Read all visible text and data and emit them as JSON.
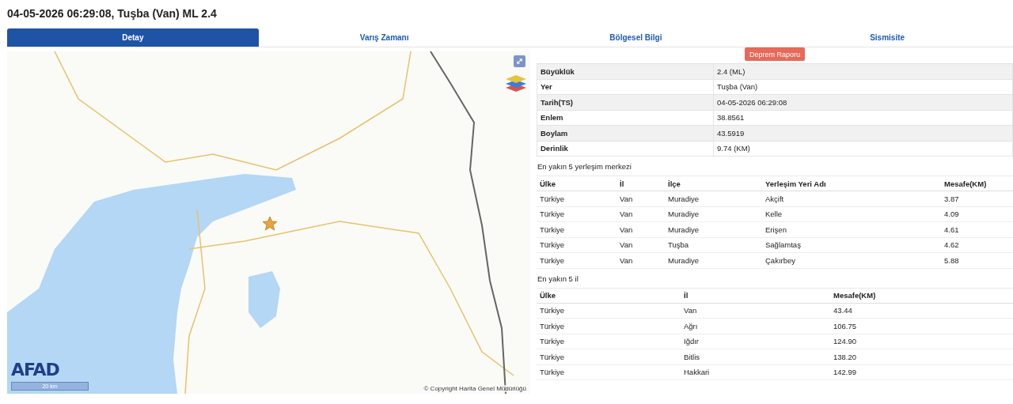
{
  "title": "04-05-2026 06:29:08, Tuşba (Van) ML 2.4",
  "tabs": [
    {
      "label": "Detay",
      "selected": true
    },
    {
      "label": "Varış Zamanı",
      "selected": false
    },
    {
      "label": "Bölgesel Bilgi",
      "selected": false
    },
    {
      "label": "Sismisite",
      "selected": false
    }
  ],
  "map": {
    "logo": "AFAD",
    "scale": "20 km",
    "copyright": "© Copyright Harita Genel Müdürlüğü"
  },
  "report_button": "Deprem Raporu",
  "details": [
    {
      "label": "Büyüklük",
      "value": "2.4 (ML)"
    },
    {
      "label": "Yer",
      "value": "Tuşba (Van)"
    },
    {
      "label": "Tarih(TS)",
      "value": "04-05-2026 06:29:08"
    },
    {
      "label": "Enlem",
      "value": "38.8561"
    },
    {
      "label": "Boylam",
      "value": "43.5919"
    },
    {
      "label": "Derinlik",
      "value": "9.74 (KM)"
    }
  ],
  "settlements": {
    "caption": "En yakın 5 yerleşim merkezi",
    "columns": [
      "Ülke",
      "İl",
      "İlçe",
      "Yerleşim Yeri Adı",
      "Mesafe(KM)"
    ],
    "rows": [
      [
        "Türkiye",
        "Van",
        "Muradiye",
        "Akçift",
        "3.87"
      ],
      [
        "Türkiye",
        "Van",
        "Muradiye",
        "Kelle",
        "4.09"
      ],
      [
        "Türkiye",
        "Van",
        "Muradiye",
        "Erişen",
        "4.61"
      ],
      [
        "Türkiye",
        "Van",
        "Tuşba",
        "Sağlamtaş",
        "4.62"
      ],
      [
        "Türkiye",
        "Van",
        "Muradiye",
        "Çakırbey",
        "5.88"
      ]
    ]
  },
  "provinces": {
    "caption": "En yakın 5 il",
    "columns": [
      "Ülke",
      "İl",
      "Mesafe(KM)"
    ],
    "rows": [
      [
        "Türkiye",
        "Van",
        "43.44"
      ],
      [
        "Türkiye",
        "Ağrı",
        "106.75"
      ],
      [
        "Türkiye",
        "Iğdır",
        "124.90"
      ],
      [
        "Türkiye",
        "Bitlis",
        "138.20"
      ],
      [
        "Türkiye",
        "Hakkari",
        "142.99"
      ]
    ]
  }
}
